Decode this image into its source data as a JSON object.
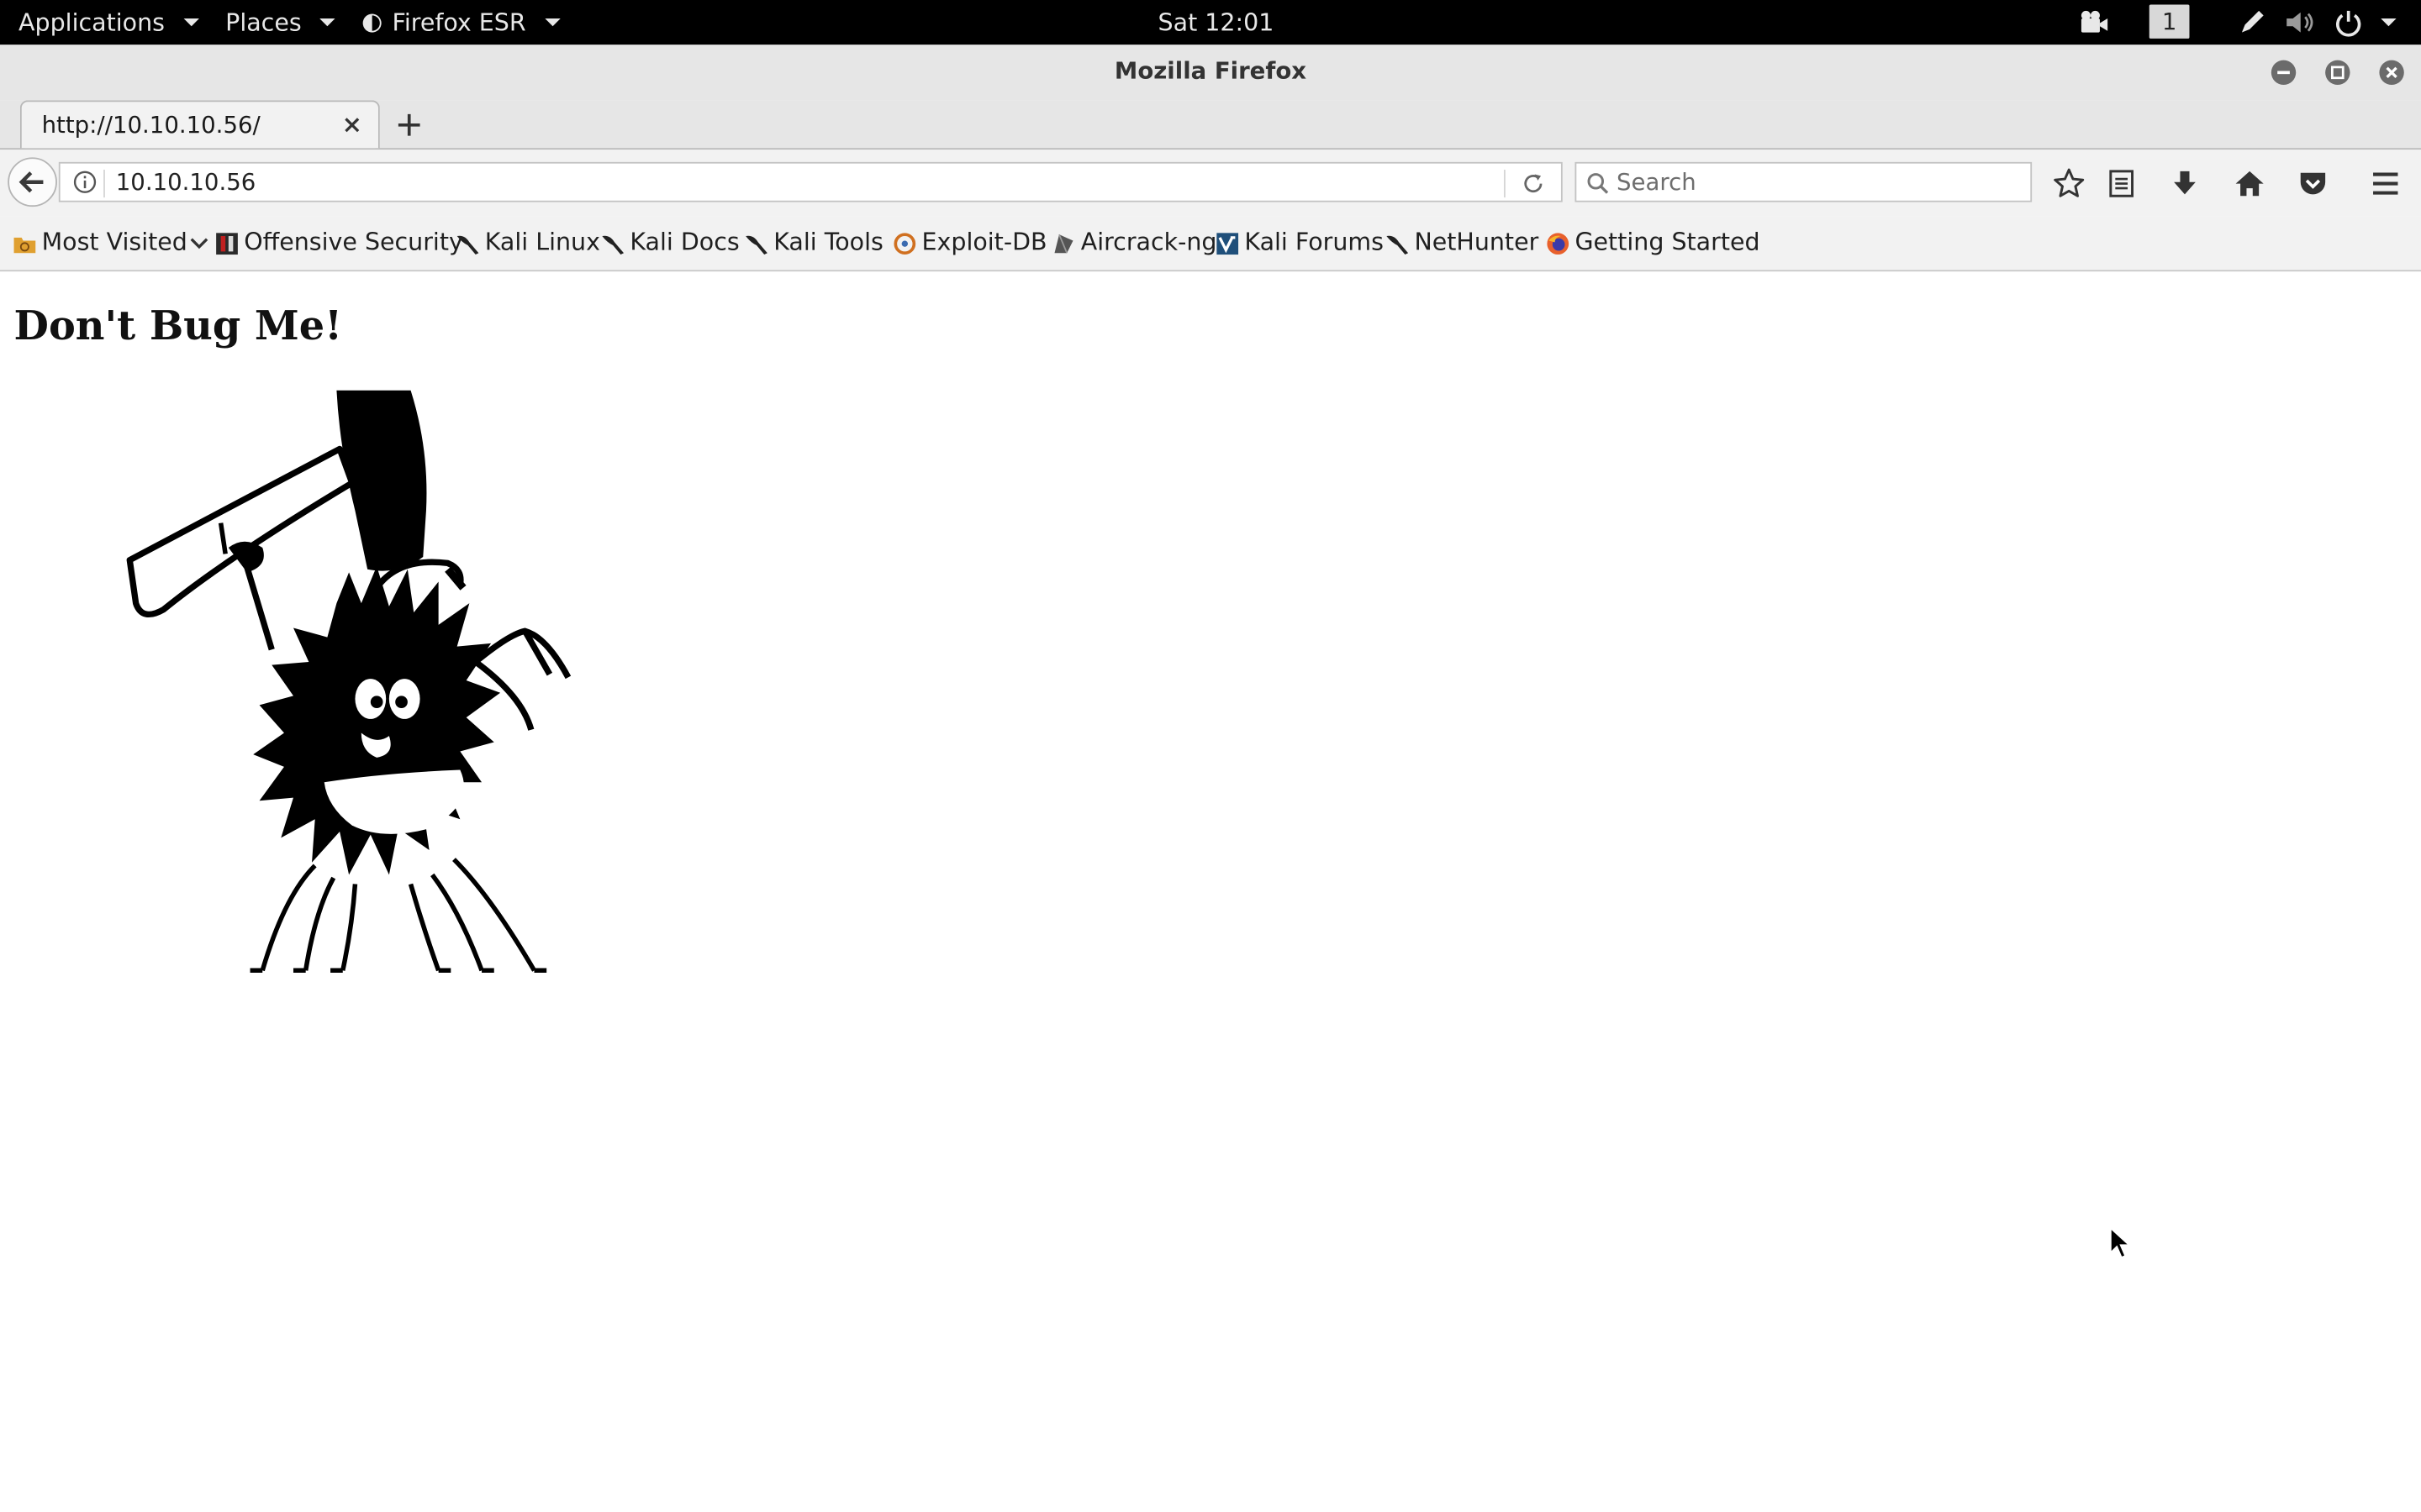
{
  "topbar": {
    "applications": "Applications",
    "places": "Places",
    "app_name": "Firefox ESR",
    "clock": "Sat 12:01",
    "workspace": "1"
  },
  "window": {
    "title": "Mozilla Firefox"
  },
  "tab": {
    "title": "http://10.10.10.56/"
  },
  "navbar": {
    "url": "10.10.10.56",
    "search_placeholder": "Search"
  },
  "bookmarks": [
    {
      "label": "Most Visited",
      "icon": "folder-icon"
    },
    {
      "label": "Offensive Security",
      "icon": "offsec-icon"
    },
    {
      "label": "Kali Linux",
      "icon": "kali-dragon-icon"
    },
    {
      "label": "Kali Docs",
      "icon": "kali-dragon-icon"
    },
    {
      "label": "Kali Tools",
      "icon": "kali-dragon-icon"
    },
    {
      "label": "Exploit-DB",
      "icon": "exploit-db-icon"
    },
    {
      "label": "Aircrack-ng",
      "icon": "aircrack-icon"
    },
    {
      "label": "Kali Forums",
      "icon": "kali-forums-icon"
    },
    {
      "label": "NetHunter",
      "icon": "kali-dragon-icon"
    },
    {
      "label": "Getting Started",
      "icon": "firefox-icon"
    }
  ],
  "page": {
    "heading": "Don't Bug Me!"
  },
  "colors": {
    "topbar_bg": "#000000",
    "chrome_bg": "#e6e6e6",
    "toolbar_bg": "#f2f2f2",
    "page_bg": "#ffffff"
  }
}
